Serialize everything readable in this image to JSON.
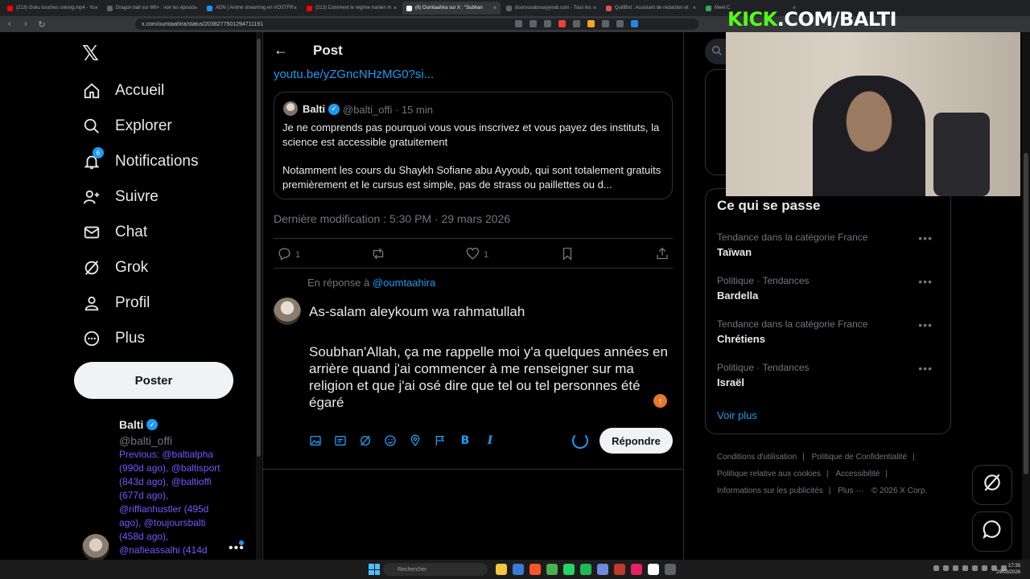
{
  "browser": {
    "tabs": [
      {
        "label": "(213) Goku touches oolong.mp4 - Yo",
        "color": "#ff0000"
      },
      {
        "label": "Dragon ball sur M6+ : voir les épisod",
        "color": "#5f6368"
      },
      {
        "label": "ADN | Animé streaming en VOSTFR",
        "color": "#1e90ff"
      },
      {
        "label": "(213) Comment le régime iranien m",
        "color": "#ff0000"
      },
      {
        "label": "(6) Oumtaahira sur X : \"Subhan",
        "color": "#ffffff",
        "active": true
      },
      {
        "label": "dourousabouayyoub.com - Tous les",
        "color": "#5f6368"
      },
      {
        "label": "QuillBot : Assistant de rédaction et",
        "color": "#d9534f"
      },
      {
        "label": "Meet C",
        "color": "#34a853"
      }
    ],
    "url": "x.com/oumtaahira/status/2038277501294711191"
  },
  "nav": {
    "items": [
      {
        "label": "Accueil",
        "icon": "home-icon"
      },
      {
        "label": "Explorer",
        "icon": "search-icon"
      },
      {
        "label": "Notifications",
        "icon": "bell-icon",
        "badge": "6"
      },
      {
        "label": "Suivre",
        "icon": "add-person-icon"
      },
      {
        "label": "Chat",
        "icon": "mail-icon"
      },
      {
        "label": "Grok",
        "icon": "grok-icon"
      },
      {
        "label": "Profil",
        "icon": "person-icon"
      },
      {
        "label": "Plus",
        "icon": "more-circle-icon"
      }
    ],
    "post_button": "Poster"
  },
  "profile": {
    "name": "Balti",
    "handle": "@balti_offi",
    "previous": "Previous: @baltialpha (990d ago), @baltisport (843d ago), @baltioffi (677d ago), @riffianhustler (495d ago), @toujoursbalti (458d ago), @nafieassalhi (414d"
  },
  "post": {
    "header_title": "Post",
    "link": "youtu.be/yZGncNHzMG0?si...",
    "quote": {
      "name": "Balti",
      "handle": "@balti_offi",
      "time": "· 15 min",
      "para1": "Je ne comprends pas pourquoi vous vous inscrivez et vous payez des instituts, la science est accessible gratuitement",
      "para2": "Notamment les cours du Shaykh Sofiane abu Ayyoub, qui sont totalement gratuits premièrement et le cursus est simple, pas de strass ou paillettes ou d..."
    },
    "last_modified": "Dernière modification : 5:30 PM · 29 mars 2026",
    "replies_count": "1",
    "likes_count": "1"
  },
  "reply": {
    "prefix": "En réponse à",
    "to_handle": "@oumtaahira",
    "line1": "As-salam aleykoum wa rahmatullah",
    "line2": "Soubhan'Allah, ça me rappelle moi y'a quelques années en arrière quand j'ai commencer à me renseigner sur ma religion et que j'ai osé dire que tel ou tel personnes été égaré",
    "button": "Répondre"
  },
  "trends": {
    "title": "Ce qui se passe",
    "items": [
      {
        "category": "Tendance dans la catégorie France",
        "name": "Taïwan"
      },
      {
        "category": "Politique · Tendances",
        "name": "Bardella"
      },
      {
        "category": "Tendance dans la catégorie France",
        "name": "Chrétiens"
      },
      {
        "category": "Politique · Tendances",
        "name": "Israël"
      }
    ],
    "see_more": "Voir plus"
  },
  "footer": {
    "links": [
      "Conditions d'utilisation",
      "Politique de Confidentialité",
      "Politique relative aux cookies",
      "Accessibilité",
      "Informations sur les publicités",
      "Plus ···",
      "© 2026 X Corp."
    ]
  },
  "overlay": {
    "kick_brand": "KICK",
    "kick_path": ".COM/BALTI"
  },
  "taskbar": {
    "search_placeholder": "Rechercher",
    "time": "17:35",
    "date": "29/03/2026"
  },
  "colors": {
    "accent": "#1d9bf0",
    "kick_green": "#53fc18",
    "background": "#000000"
  }
}
